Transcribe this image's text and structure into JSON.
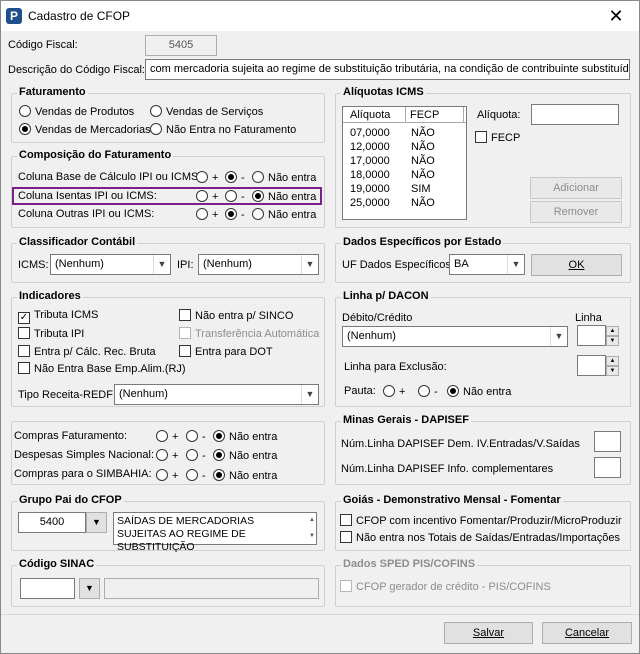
{
  "window": {
    "title": "Cadastro de CFOP",
    "app_icon_letter": "P"
  },
  "codigo": {
    "label": "Código Fiscal:",
    "value": "5405"
  },
  "descricao": {
    "label": "Descrição do Código Fiscal:",
    "value": "com mercadoria sujeita ao regime de substituição tributária, na condição de contribuinte substituído"
  },
  "faturamento": {
    "title": "Faturamento",
    "vendas_produtos": "Vendas de Produtos",
    "vendas_servicos": "Vendas de Serviços",
    "vendas_mercadorias": "Vendas de Mercadorias",
    "nao_entra": "Não Entra no Faturamento"
  },
  "composicao": {
    "title": "Composição do Faturamento",
    "rows": [
      {
        "label": "Coluna Base de Cálculo IPI ou ICMS:"
      },
      {
        "label": "Coluna Isentas IPI ou ICMS:"
      },
      {
        "label": "Coluna Outras IPI ou ICMS:"
      }
    ],
    "plus": "+",
    "minus": "-",
    "nao_entra": "Não entra"
  },
  "aliquotas": {
    "title": "Alíquotas ICMS",
    "col1": "Alíquota",
    "col2": "FECP",
    "rows": [
      [
        "07,0000",
        "NÃO"
      ],
      [
        "12,0000",
        "NÃO"
      ],
      [
        "17,0000",
        "NÃO"
      ],
      [
        "18,0000",
        "NÃO"
      ],
      [
        "19,0000",
        "SIM"
      ],
      [
        "25,0000",
        "NÃO"
      ]
    ],
    "aliquota_label": "Alíquota:",
    "fecp_label": "FECP",
    "adicionar": "Adicionar",
    "remover": "Remover"
  },
  "classificador": {
    "title": "Classificador Contábil",
    "icms_label": "ICMS:",
    "icms_value": "(Nenhum)",
    "ipi_label": "IPI:",
    "ipi_value": "(Nenhum)"
  },
  "dados_estado": {
    "title": "Dados Específicos por Estado",
    "uf_label": "UF Dados Específicos:",
    "uf_value": "BA",
    "ok": "OK"
  },
  "indicadores": {
    "title": "Indicadores",
    "tributa_icms": "Tributa ICMS",
    "nao_sinco": "Não entra p/ SINCO",
    "tributa_ipi": "Tributa IPI",
    "transferencia": "Transferência Automática",
    "entra_calc": "Entra p/ Cálc. Rec. Bruta",
    "entra_dot": "Entra para DOT",
    "nao_entra_base": "Não Entra Base Emp.Alim.(RJ)",
    "tipo_receita_label": "Tipo Receita-REDF:",
    "tipo_receita_value": "(Nenhum)"
  },
  "dacon": {
    "title": "Linha p/ DACON",
    "debito_label": "Débito/Crédito",
    "debito_value": "(Nenhum)",
    "linha_label": "Linha",
    "exclusao_label": "Linha para Exclusão:",
    "pauta_label": "Pauta:",
    "plus": "+",
    "minus": "-",
    "nao_entra": "Não entra"
  },
  "compras": {
    "rows": [
      {
        "label": "Compras Faturamento:"
      },
      {
        "label": "Despesas Simples Nacional:"
      },
      {
        "label": "Compras para o SIMBAHIA:"
      }
    ],
    "plus": "+",
    "minus": "-",
    "nao_entra": "Não entra"
  },
  "minas": {
    "title": "Minas Gerais - DAPISEF",
    "dem_label": "Núm.Linha DAPISEF Dem. IV.Entradas/V.Saídas",
    "info_label": "Núm.Linha DAPISEF Info. complementares"
  },
  "grupo_pai": {
    "title": "Grupo Pai do CFOP",
    "code": "5400",
    "desc": "SAÍDAS DE MERCADORIAS SUJEITAS AO REGIME DE SUBSTITUIÇÃO"
  },
  "goias": {
    "title": "Goiás - Demonstrativo Mensal - Fomentar",
    "incentivo": "CFOP com incentivo  Fomentar/Produzir/MicroProduzir",
    "totais": "Não entra nos Totais de  Saídas/Entradas/Importações"
  },
  "sinac": {
    "title": "Código SINAC"
  },
  "sped": {
    "title": "Dados SPED PIS/COFINS",
    "gerador": "CFOP gerador de crédito - PIS/COFINS"
  },
  "footer": {
    "salvar": "Salvar",
    "cancelar": "Cancelar"
  },
  "colors": {
    "highlight": "#7b1f8f",
    "app_icon": "#1e4f8c"
  }
}
